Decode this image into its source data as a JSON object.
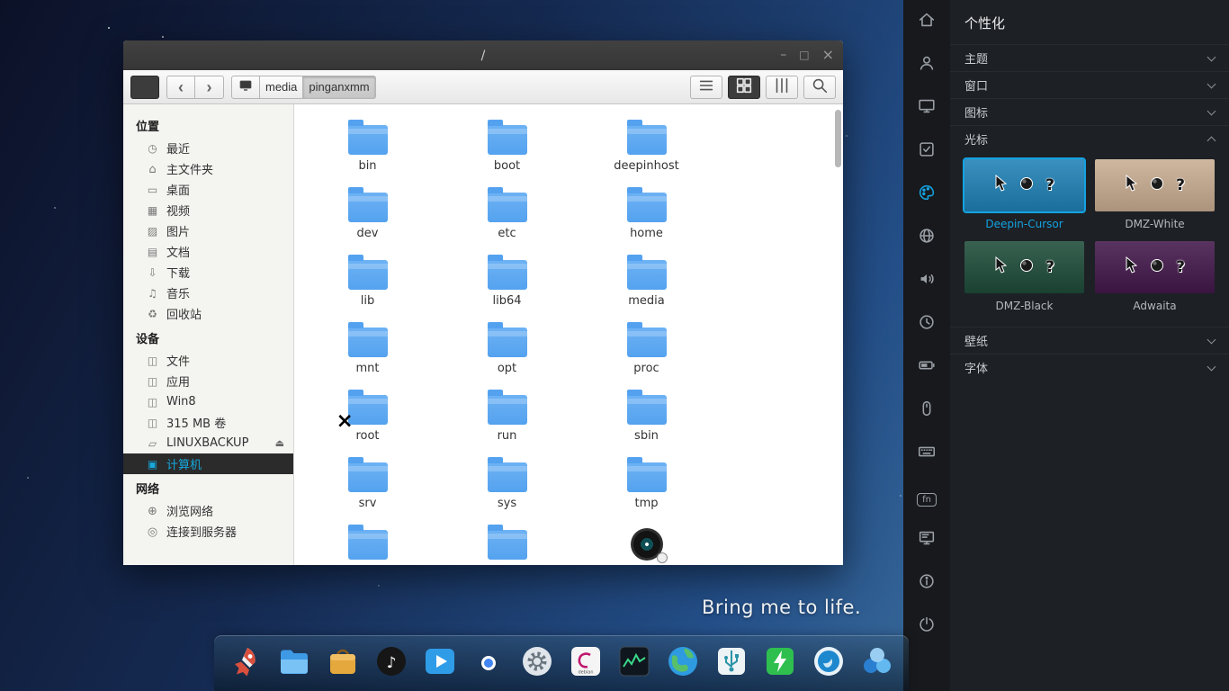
{
  "desktop": {
    "caption": "Bring me to life."
  },
  "file_manager": {
    "title": "/",
    "window_controls": [
      {
        "name": "minimize-icon",
        "glyph": "minimize-icon"
      },
      {
        "name": "maximize-icon",
        "glyph": "maximize-icon"
      },
      {
        "name": "close-icon",
        "glyph": "close-icon"
      }
    ],
    "toolbar": {
      "breadcrumb_root_icon": "breadcrumb-computer-icon",
      "breadcrumb": [
        {
          "label": "media",
          "active": false
        },
        {
          "label": "pinganxmm",
          "active": true
        }
      ],
      "view_buttons": [
        {
          "icon": "list-view-icon",
          "active": false
        },
        {
          "icon": "icon-view-icon",
          "active": true
        },
        {
          "icon": "compact-view-icon",
          "active": false
        }
      ]
    },
    "sidebar": {
      "sections": [
        {
          "title": "位置",
          "items": [
            {
              "label": "最近",
              "icon": "recent-icon"
            },
            {
              "label": "主文件夹",
              "icon": "homedir-icon"
            },
            {
              "label": "桌面",
              "icon": "desktop-icon"
            },
            {
              "label": "视频",
              "icon": "videos-icon"
            },
            {
              "label": "图片",
              "icon": "pictures-icon"
            },
            {
              "label": "文档",
              "icon": "documents-icon"
            },
            {
              "label": "下载",
              "icon": "downloads-icon"
            },
            {
              "label": "音乐",
              "icon": "music-note-icon"
            },
            {
              "label": "回收站",
              "icon": "trash-icon"
            }
          ]
        },
        {
          "title": "设备",
          "items": [
            {
              "label": "文件",
              "icon": "drive-icon"
            },
            {
              "label": "应用",
              "icon": "drive-icon"
            },
            {
              "label": "Win8",
              "icon": "drive-icon"
            },
            {
              "label": "315 MB 卷",
              "icon": "drive-icon"
            },
            {
              "label": "LINUXBACKUP",
              "icon": "sdcard-icon",
              "eject": true
            },
            {
              "label": "计算机",
              "icon": "computer-icon",
              "active": true
            }
          ]
        },
        {
          "title": "网络",
          "items": [
            {
              "label": "浏览网络",
              "icon": "network-globe-icon"
            },
            {
              "label": "连接到服务器",
              "icon": "server-icon"
            }
          ]
        }
      ]
    },
    "folders": [
      {
        "name": "bin"
      },
      {
        "name": "boot"
      },
      {
        "name": "deepinhost"
      },
      {
        "name": "dev"
      },
      {
        "name": "etc"
      },
      {
        "name": "home"
      },
      {
        "name": "lib"
      },
      {
        "name": "lib64"
      },
      {
        "name": "media"
      },
      {
        "name": "mnt"
      },
      {
        "name": "opt"
      },
      {
        "name": "proc"
      },
      {
        "name": "root",
        "overlay": "x-cursor"
      },
      {
        "name": "run"
      },
      {
        "name": "sbin"
      },
      {
        "name": "srv"
      },
      {
        "name": "sys"
      },
      {
        "name": "tmp"
      }
    ],
    "partial_row": [
      "folder",
      "folder",
      "disc"
    ]
  },
  "control_center": {
    "title": "个性化",
    "accent": "#14a3e1",
    "sections": [
      {
        "label": "主题",
        "expanded": false
      },
      {
        "label": "窗口",
        "expanded": false
      },
      {
        "label": "图标",
        "expanded": false
      },
      {
        "label": "光标",
        "expanded": true
      },
      {
        "label": "壁纸",
        "expanded": false
      },
      {
        "label": "字体",
        "expanded": false
      }
    ],
    "cursor_themes": [
      {
        "name": "Deepin-Cursor",
        "selected": true,
        "bg": "#1f81b6"
      },
      {
        "name": "DMZ-White",
        "selected": false,
        "bg": "#c9ad92"
      },
      {
        "name": "DMZ-Black",
        "selected": false,
        "bg": "#1e4c39"
      },
      {
        "name": "Adwaita",
        "selected": false,
        "bg": "#43184b"
      }
    ],
    "nav": [
      {
        "icon": "nav-home-icon"
      },
      {
        "icon": "account-icon"
      },
      {
        "icon": "display-icon"
      },
      {
        "icon": "default-apps-icon"
      },
      {
        "icon": "personalization-icon",
        "active": true
      },
      {
        "icon": "network-icon"
      },
      {
        "icon": "sound-icon"
      },
      {
        "icon": "datetime-icon"
      },
      {
        "icon": "power-icon"
      },
      {
        "icon": "mouse-icon"
      },
      {
        "icon": "keyboard-icon"
      },
      {
        "icon": "shortcuts-icon"
      },
      {
        "icon": "system-info-icon"
      },
      {
        "icon": "info-icon"
      },
      {
        "icon": "shutdown-icon"
      }
    ]
  },
  "dock": {
    "items": [
      {
        "icon": "launcher-icon"
      },
      {
        "icon": "file-manager-icon"
      },
      {
        "icon": "app-store-icon"
      },
      {
        "icon": "music-player-icon"
      },
      {
        "icon": "movie-icon"
      },
      {
        "icon": "chrome-icon"
      },
      {
        "icon": "settings-icon"
      },
      {
        "icon": "debian-icon"
      },
      {
        "icon": "system-monitor-icon"
      },
      {
        "icon": "browser-earth-icon"
      },
      {
        "icon": "usb-icon"
      },
      {
        "icon": "battery-icon"
      },
      {
        "icon": "deepin-icon"
      },
      {
        "icon": "colors-icon"
      }
    ]
  }
}
